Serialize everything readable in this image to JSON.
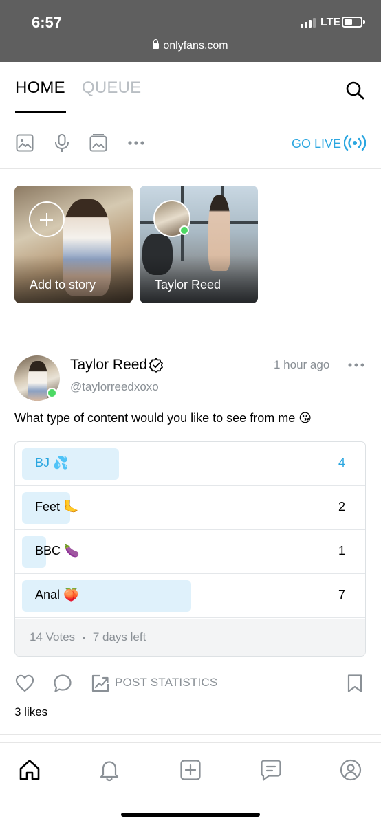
{
  "status_bar": {
    "time": "6:57",
    "network": "LTE"
  },
  "browser": {
    "url": "onlyfans.com"
  },
  "tabs": [
    {
      "label": "HOME",
      "active": true
    },
    {
      "label": "QUEUE",
      "active": false
    }
  ],
  "toolbar": {
    "go_live_label": "GO LIVE"
  },
  "stories": [
    {
      "label": "Add to story"
    },
    {
      "label": "Taylor Reed"
    }
  ],
  "post": {
    "author_name": "Taylor Reed",
    "author_handle": "@taylorreedxoxo",
    "time": "1 hour ago",
    "text": "What type of content would you like to see from me 😘",
    "poll": {
      "options": [
        {
          "label": "BJ 💦",
          "votes": "4",
          "share": 0.5714
        },
        {
          "label": "Feet 🦶",
          "votes": "2",
          "share": 0.2857
        },
        {
          "label": "BBC 🍆",
          "votes": "1",
          "share": 0.1429
        },
        {
          "label": "Anal 🍑",
          "votes": "7",
          "share": 1.0
        }
      ],
      "votes_text": "14 Votes",
      "separator": "•",
      "time_left": "7 days left"
    },
    "post_statistics_label": "POST STATISTICS",
    "likes_text": "3 likes"
  },
  "colors": {
    "accent": "#2aa6e0",
    "online": "#4cd964",
    "muted": "#8a9096",
    "poll_bar": "#dff1fb"
  },
  "icons": [
    "search-icon",
    "image-icon",
    "microphone-icon",
    "gallery-icon",
    "more-icon",
    "live-icon",
    "verified-icon",
    "heart-icon",
    "comment-icon",
    "stats-icon",
    "bookmark-icon",
    "home-icon",
    "bell-icon",
    "plus-square-icon",
    "message-icon",
    "profile-icon"
  ]
}
